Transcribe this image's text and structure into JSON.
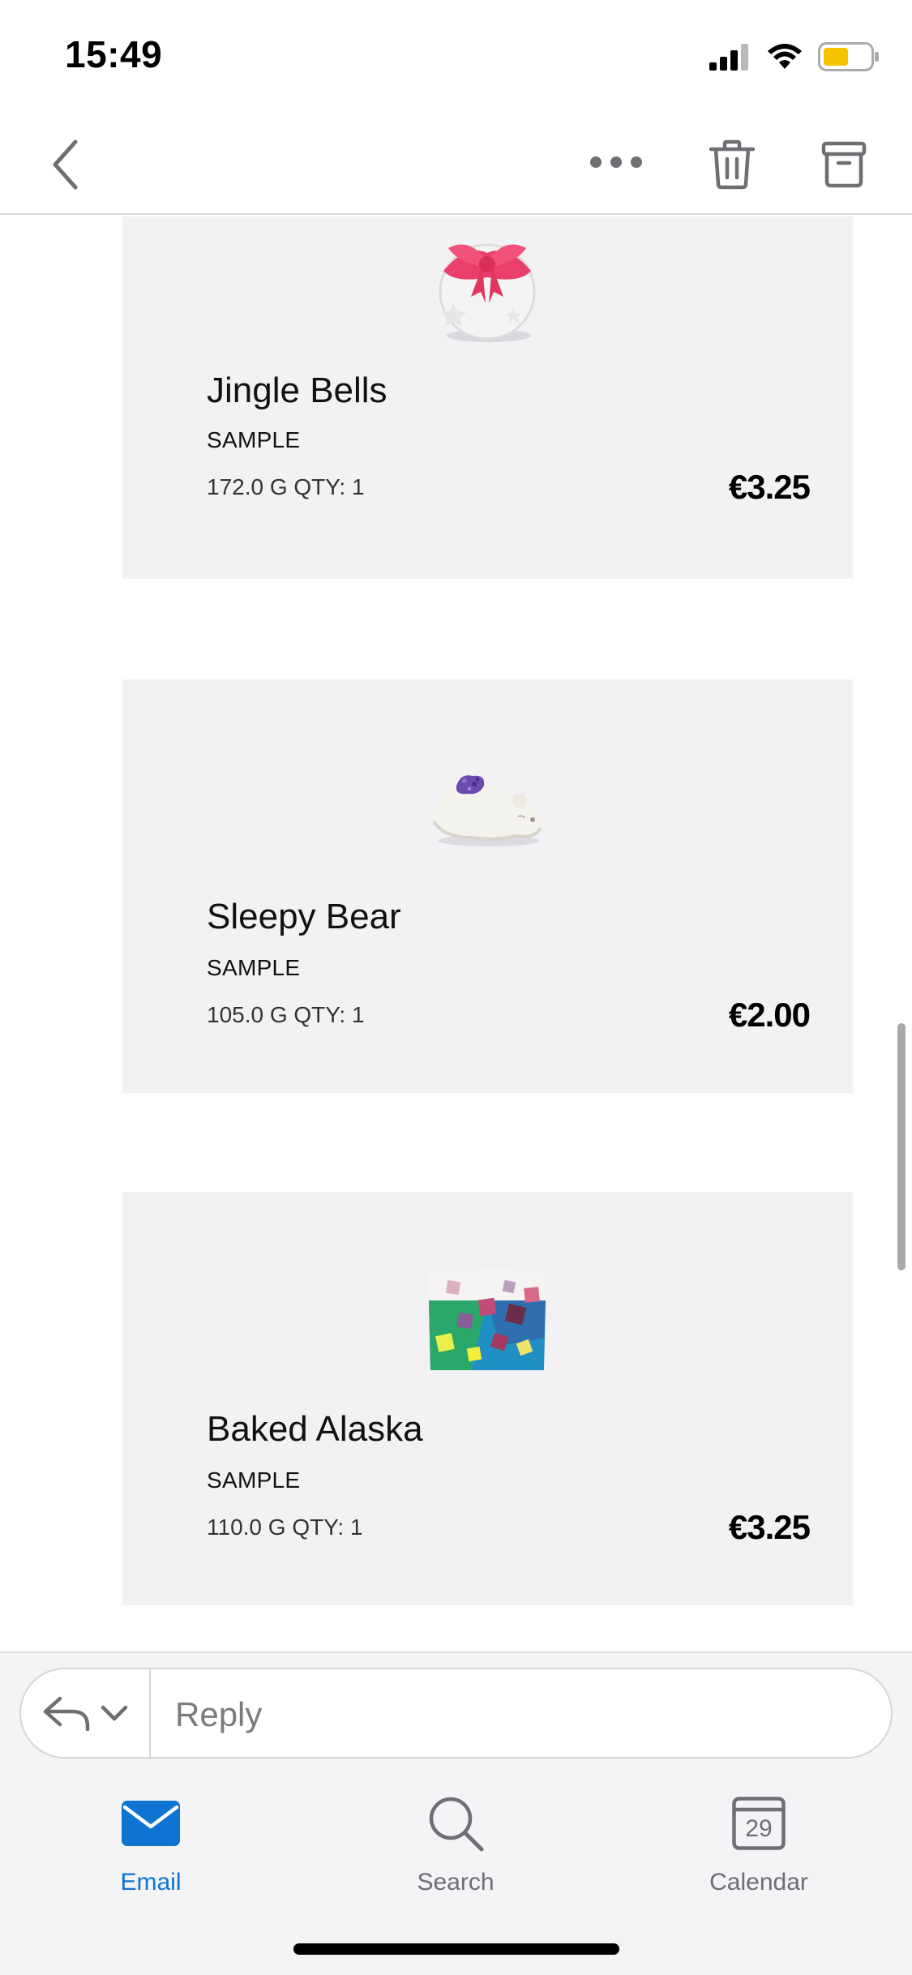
{
  "status_bar": {
    "time": "15:49",
    "icons": [
      "cellular-signal-icon",
      "wifi-icon",
      "battery-icon"
    ],
    "battery_color": "#f5c400"
  },
  "nav": {
    "back_icon": "chevron-left-icon",
    "more_icon": "more-horizontal-icon",
    "trash_icon": "trash-icon",
    "archive_icon": "archive-icon"
  },
  "products": [
    {
      "name": "Jingle Bells",
      "type": "SAMPLE",
      "meta": "172.0 G QTY: 1",
      "price": "€3.25",
      "image_icon": "bath-bomb-bow-image"
    },
    {
      "name": "Sleepy Bear",
      "type": "SAMPLE",
      "meta": "105.0 G QTY: 1",
      "price": "€2.00",
      "image_icon": "bear-bath-bomb-image"
    },
    {
      "name": "Baked Alaska",
      "type": "SAMPLE",
      "meta": "110.0 G QTY: 1",
      "price": "€3.25",
      "image_icon": "soap-bar-image"
    }
  ],
  "reply": {
    "placeholder": "Reply",
    "reply_icon": "reply-icon",
    "dropdown_icon": "chevron-down-icon"
  },
  "tabs": [
    {
      "label": "Email",
      "icon": "mail-icon",
      "active": true
    },
    {
      "label": "Search",
      "icon": "search-icon",
      "active": false
    },
    {
      "label": "Calendar",
      "icon": "calendar-icon",
      "active": false,
      "date": "29"
    }
  ],
  "colors": {
    "accent": "#0f74d1",
    "card_background": "#f2f1f4"
  }
}
